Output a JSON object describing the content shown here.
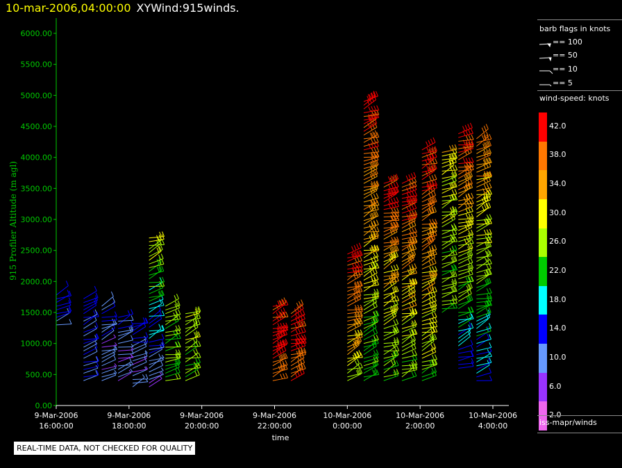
{
  "header": {
    "time": "10-mar-2006,04:00:00",
    "title": "XYWind:915winds."
  },
  "notice": "REAL-TIME DATA, NOT CHECKED FOR QUALITY",
  "legend": {
    "barb_title": "barb flags in knots",
    "barbs": [
      "== 100",
      "== 50",
      "== 10",
      "== 5"
    ],
    "speed_title": "wind-speed: knots",
    "speed_labels": [
      "42.0",
      "38.0",
      "34.0",
      "30.0",
      "26.0",
      "22.0",
      "18.0",
      "14.0",
      "10.0",
      "6.0",
      "2.0"
    ],
    "source": "iss-mapr/winds",
    "colors": [
      "#ff0000",
      "#ff7700",
      "#ffa500",
      "#ffff00",
      "#aaff00",
      "#00cc00",
      "#00ffff",
      "#0000ff",
      "#6699ff",
      "#9933ff",
      "#ee66ee"
    ]
  },
  "chart_data": {
    "type": "scatter",
    "title": "XYWind:915winds.",
    "xlabel": "time",
    "ylabel": "915 Profiler Altitude (m agl)",
    "ylim": [
      0,
      6000
    ],
    "xlim": [
      -12,
      0
    ],
    "y_ticks": [
      "0.00",
      "500.00",
      "1000.00",
      "1500.00",
      "2000.00",
      "2500.00",
      "3000.00",
      "3500.00",
      "4000.00",
      "4500.00",
      "5000.00",
      "5500.00",
      "6000.00"
    ],
    "x_ticks": [
      {
        "h": -12,
        "date": "9-Mar-2006",
        "time": "16:00:00"
      },
      {
        "h": -10,
        "date": "9-Mar-2006",
        "time": "18:00:00"
      },
      {
        "h": -8,
        "date": "9-Mar-2006",
        "time": "20:00:00"
      },
      {
        "h": -6,
        "date": "9-Mar-2006",
        "time": "22:00:00"
      },
      {
        "h": -4,
        "date": "10-Mar-2006",
        "time": "0:00:00"
      },
      {
        "h": -2,
        "date": "10-Mar-2006",
        "time": "2:00:00"
      },
      {
        "h": 0,
        "date": "10-Mar-2006",
        "time": "4:00:00"
      }
    ],
    "barb_scale_knots": [
      100,
      50,
      10,
      5
    ],
    "columns": [
      {
        "t": -12.0,
        "alt": [
          1300,
          1750
        ],
        "speed": 13,
        "speed_top": 13
      },
      {
        "t": -11.25,
        "alt": [
          400,
          1700
        ],
        "speed": 10,
        "speed_top": 13
      },
      {
        "t": -10.75,
        "alt": [
          400,
          1600
        ],
        "speed": 7,
        "speed_top": 13
      },
      {
        "t": -10.3,
        "alt": [
          400,
          1400
        ],
        "speed": 7,
        "speed_top": 14
      },
      {
        "t": -9.9,
        "alt": [
          300,
          1300
        ],
        "speed": 7,
        "speed_top": 13
      },
      {
        "t": -9.45,
        "alt": [
          300,
          2700
        ],
        "speed": 7,
        "speed_top": 30
      },
      {
        "t": -9.0,
        "alt": [
          400,
          1600
        ],
        "speed": 23,
        "speed_top": 25
      },
      {
        "t": -8.45,
        "alt": [
          400,
          1500
        ],
        "speed": 24,
        "speed_top": 27
      },
      {
        "t": -6.05,
        "alt": [
          400,
          1600
        ],
        "speed": 38,
        "speed_top": 42
      },
      {
        "t": -5.55,
        "alt": [
          400,
          1500
        ],
        "speed": 38,
        "speed_top": 42
      },
      {
        "t": -4.0,
        "alt": [
          400,
          2450
        ],
        "speed": 28,
        "speed_top": 42
      },
      {
        "t": -3.55,
        "alt": [
          400,
          4900
        ],
        "speed": 21,
        "speed_top": 42
      },
      {
        "t": -3.0,
        "alt": [
          400,
          3600
        ],
        "speed": 22,
        "speed_top": 42
      },
      {
        "t": -2.5,
        "alt": [
          400,
          3600
        ],
        "speed": 24,
        "speed_top": 42
      },
      {
        "t": -1.95,
        "alt": [
          400,
          4100
        ],
        "speed": 25,
        "speed_top": 42
      },
      {
        "t": -1.4,
        "alt": [
          1500,
          4100
        ],
        "speed": 24,
        "speed_top": 30
      },
      {
        "t": -0.95,
        "alt": [
          600,
          4350
        ],
        "speed": 14,
        "speed_top": 42
      },
      {
        "t": -0.45,
        "alt": [
          400,
          4300
        ],
        "speed": 14,
        "speed_top": 38
      }
    ]
  }
}
